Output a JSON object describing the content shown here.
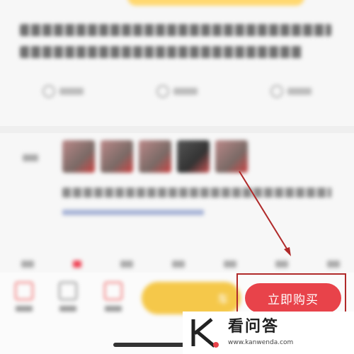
{
  "footer": {
    "cart_label": "车",
    "buy_label": "立即购买"
  },
  "watermark": {
    "brand": "看问答",
    "url": "www.kanwenda.com"
  },
  "colors": {
    "accent_red": "#e8434a",
    "cart_yellow": "#f5c84a",
    "annotation_red": "#b02a2a"
  }
}
